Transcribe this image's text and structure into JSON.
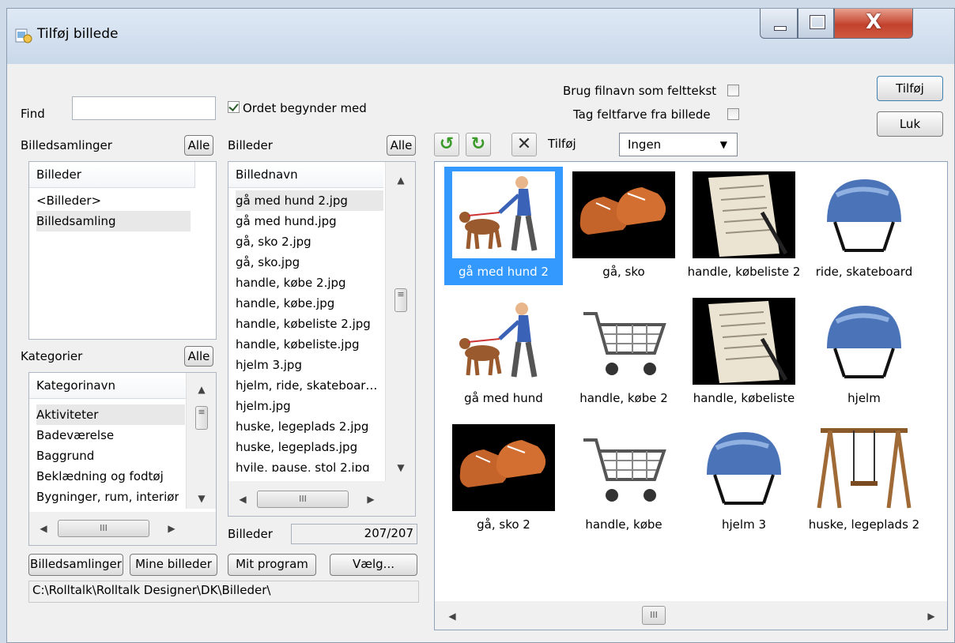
{
  "window": {
    "title": "Tilføj billede",
    "close_glyph": "X"
  },
  "find": {
    "label": "Find",
    "value": "",
    "checkbox_label": "Ordet begynder med",
    "checked": true
  },
  "collections": {
    "label": "Billedsamlinger",
    "all_button": "Alle",
    "header": "Billeder",
    "items": [
      "<Billeder>",
      "Billedsamling"
    ]
  },
  "categories": {
    "label": "Kategorier",
    "all_button": "Alle",
    "header": "Kategorinavn",
    "items": [
      "Aktiviteter",
      "Badeværelse",
      "Baggrund",
      "Beklædning og fodtøj",
      "Bygninger, rum, interiør"
    ]
  },
  "images": {
    "label": "Billeder",
    "all_button": "Alle",
    "header": "Billednavn",
    "items": [
      "gå med hund 2.jpg",
      "gå med hund.jpg",
      "gå, sko 2.jpg",
      "gå, sko.jpg",
      "handle, købe 2.jpg",
      "handle, købe.jpg",
      "handle, købeliste 2.jpg",
      "handle, købeliste.jpg",
      "hjelm 3.jpg",
      "hjelm, ride, skateboar…",
      "hjelm.jpg",
      "huske, legeplads 2.jpg",
      "huske, legeplads.jpg",
      "hvile, pause, stol 2.jpg"
    ],
    "count_label": "Billeder",
    "count_value": "207/207"
  },
  "bottom_buttons": {
    "collections": "Billedsamlinger",
    "my_images": "Mine billeder",
    "my_program": "Mit program",
    "choose": "Vælg..."
  },
  "path": "C:\\Rolltalk\\Rolltalk Designer\\DK\\Billeder\\",
  "options": {
    "filename_as_text": "Brug filnavn som felttekst",
    "color_from_image": "Tag feltfarve fra billede"
  },
  "actions": {
    "add": "Tilføj",
    "close": "Luk"
  },
  "toolbar": {
    "add_label": "Tilføj",
    "combo_value": "Ingen",
    "scroll_thumb_glyph": "III"
  },
  "thumbnails": [
    {
      "caption": "gå med hund 2",
      "icon": "dog-walk-icon",
      "selected": true
    },
    {
      "caption": "gå, sko",
      "icon": "shoes-icon"
    },
    {
      "caption": "handle, købeliste 2",
      "icon": "shopping-list-icon"
    },
    {
      "caption": "ride, skateboard",
      "icon": "helmet-icon"
    },
    {
      "caption": "gå med hund",
      "icon": "dog-walk-icon"
    },
    {
      "caption": "handle, købe 2",
      "icon": "cart-icon"
    },
    {
      "caption": "handle, købeliste",
      "icon": "shopping-list-icon"
    },
    {
      "caption": "hjelm",
      "icon": "helmet-icon"
    },
    {
      "caption": "gå, sko 2",
      "icon": "shoes-icon"
    },
    {
      "caption": "handle, købe",
      "icon": "cart-icon"
    },
    {
      "caption": "hjelm 3",
      "icon": "helmet-icon"
    },
    {
      "caption": "huske, legeplads 2",
      "icon": "swing-icon"
    }
  ],
  "colors": {
    "selection": "#3399ff",
    "close_button": "#c3422d",
    "rotate_green": "#3a9a2a"
  }
}
